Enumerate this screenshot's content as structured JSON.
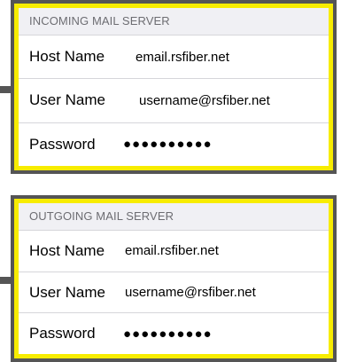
{
  "incoming": {
    "header": "INCOMING MAIL SERVER",
    "host_label": "Host Name",
    "host_value": "email.rsfiber.net",
    "user_label": "User Name",
    "user_value": "username@rsfiber.net",
    "password_label": "Password",
    "password_value": "●●●●●●●●●●"
  },
  "outgoing": {
    "header": "OUTGOING MAIL SERVER",
    "host_label": "Host Name",
    "host_value": "email.rsfiber.net",
    "user_label": "User Name",
    "user_value": "username@rsfiber.net",
    "password_label": "Password",
    "password_value": "●●●●●●●●●●"
  },
  "colors": {
    "highlight_border": "#f7ec00",
    "frame": "#555555",
    "section_header_bg": "#f0f0f4",
    "section_header_text": "#6d6d72"
  }
}
